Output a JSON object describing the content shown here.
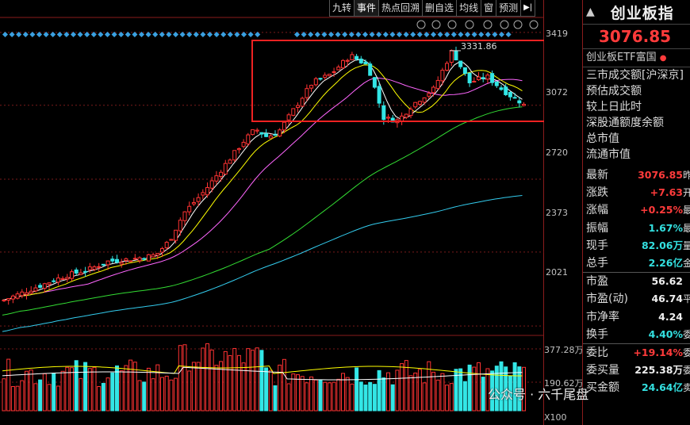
{
  "toolbar": {
    "items": [
      "九转",
      "事件",
      "热点回溯",
      "删自选",
      "均线",
      "窗",
      "预测"
    ]
  },
  "axis": {
    "price_ticks": [
      {
        "label": "3419",
        "value": 3419
      },
      {
        "label": "3072",
        "value": 3072
      },
      {
        "label": "2720",
        "value": 2720
      },
      {
        "label": "2373",
        "value": 2373
      },
      {
        "label": "2021",
        "value": 2021
      }
    ],
    "volume_ticks": [
      {
        "label": "377.28万"
      },
      {
        "label": "190.62万"
      }
    ],
    "volume_unit": "X100"
  },
  "chart_data": {
    "type": "candlestick",
    "peak_annotation": "3331.86",
    "peak_value": 3331.86,
    "last_close": 3076.85,
    "ylim": [
      1980,
      3460
    ],
    "colors": {
      "up": "#ff3333",
      "down": "#33e6e6",
      "ma5": "#ffffff",
      "ma10": "#ffff00",
      "ma20": "#ff66ff",
      "ma60": "#33dd33",
      "ma120": "#33ccee"
    }
  },
  "right_panel": {
    "title": "创业板指",
    "price": "3076.85",
    "link": "创业板ETF富国",
    "list": [
      "三市成交额[沪深京]",
      "预估成交额",
      "较上日此时",
      "深股通额度余额",
      "总市值",
      "流通市值"
    ],
    "rows": [
      {
        "k": "最新",
        "v": "3076.85",
        "u": "昨",
        "c": "red"
      },
      {
        "k": "涨跌",
        "v": "+7.63",
        "u": "开",
        "c": "red"
      },
      {
        "k": "涨幅",
        "v": "+0.25%",
        "u": "最",
        "c": "red"
      },
      {
        "k": "振幅",
        "v": "1.67%",
        "u": "最",
        "c": "cyan"
      },
      {
        "k": "现手",
        "v": "82.06万",
        "u": "量",
        "c": "cyan"
      },
      {
        "k": "总手",
        "v": "2.26亿",
        "u": "金",
        "c": "cyan"
      },
      {
        "k": "市盈",
        "v": "56.62",
        "u": "",
        "c": "white"
      },
      {
        "k": "市盈(动)",
        "v": "46.74",
        "u": "平",
        "c": "white"
      },
      {
        "k": "市净率",
        "v": "4.24",
        "u": "",
        "c": "white"
      },
      {
        "k": "换手",
        "v": "4.40%",
        "u": "委",
        "c": "cyan"
      },
      {
        "k": "委比",
        "v": "+19.14%",
        "u": "委",
        "c": "red"
      },
      {
        "k": "委买量",
        "v": "225.38万",
        "u": "委",
        "c": "white"
      },
      {
        "k": "买金额",
        "v": "24.64亿",
        "u": "卖",
        "c": "cyan"
      }
    ]
  },
  "watermark": "公众号 · 六千尾盘"
}
